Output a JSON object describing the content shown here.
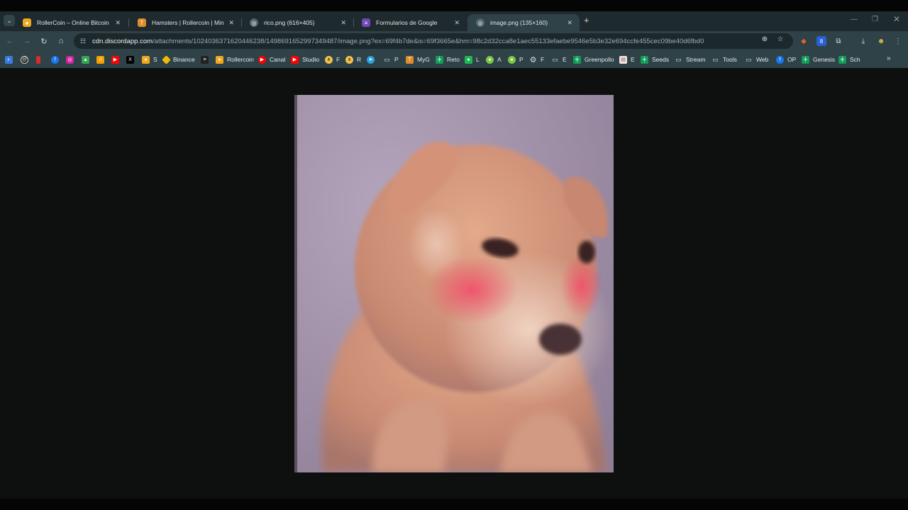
{
  "tabs": [
    {
      "title": "RollerCoin – Online Bitcoin Mining",
      "favicon": "rollercoin-hamster-icon",
      "color": "#f2a81d",
      "active": false
    },
    {
      "title": "Hamsters | Rollercoin | Minar y",
      "favicon": "hamsters-t-icon",
      "color": "#e08b2c",
      "active": false
    },
    {
      "title": "rico.png (616×405)",
      "favicon": "globe-icon",
      "color": "#8a9aa0",
      "active": false
    },
    {
      "title": "Formularios de Google",
      "favicon": "google-forms-icon",
      "color": "#7248b9",
      "active": false
    },
    {
      "title": "image.png (135×160)",
      "favicon": "globe-icon",
      "color": "#8a9aa0",
      "active": true
    }
  ],
  "address": {
    "host": "cdn.discordapp.com",
    "path": "/attachments/1024036371620446238/1498691652997349487/image.png?ex=69f4b7de&is=69f3665e&hm=98c2d32cca8e1aec55133efaebe9546e5b3e32e694ccfe455cec09be40d6fbd0"
  },
  "bookmarks": [
    {
      "label": "",
      "icon": "photos-icon",
      "color": "#3b7be0"
    },
    {
      "label": "",
      "icon": "threads-icon",
      "color": "#111111"
    },
    {
      "label": "",
      "icon": "bar-icon",
      "color": "#d92b2b"
    },
    {
      "label": "",
      "icon": "facebook-icon",
      "color": "#1877f2"
    },
    {
      "label": "",
      "icon": "instagram-icon",
      "color": "#d6249f"
    },
    {
      "label": "",
      "icon": "drive-icon",
      "color": "#34a853"
    },
    {
      "label": "",
      "icon": "analytics-icon",
      "color": "#f4a000"
    },
    {
      "label": "",
      "icon": "youtube-icon",
      "color": "#ff0000"
    },
    {
      "label": "",
      "icon": "x-icon",
      "color": "#000000"
    },
    {
      "label": "S",
      "icon": "rollercoin-icon",
      "color": "#f2a81d"
    },
    {
      "label": "Binance",
      "icon": "binance-icon",
      "color": "#f0b90b"
    },
    {
      "label": "",
      "icon": "dark-site-icon",
      "color": "#222222"
    },
    {
      "label": "Rollercoin",
      "icon": "rollercoin-icon",
      "color": "#f2a81d"
    },
    {
      "label": "Canal",
      "icon": "youtube-icon",
      "color": "#ff0000"
    },
    {
      "label": "Studio",
      "icon": "youtube-studio-icon",
      "color": "#ff0000"
    },
    {
      "label": "F",
      "icon": "hamster-icon",
      "color": "#f2c14e"
    },
    {
      "label": "R",
      "icon": "hamster-icon",
      "color": "#f2c14e"
    },
    {
      "label": "",
      "icon": "telegram-icon",
      "color": "#2aa3de"
    },
    {
      "label": "P",
      "icon": "folder-icon",
      "color": "#d7dfe1"
    },
    {
      "label": "MyG",
      "icon": "myg-icon",
      "color": "#e08b2c"
    },
    {
      "label": "Reto",
      "icon": "sheets-icon",
      "color": "#0f9d58"
    },
    {
      "label": "L",
      "icon": "green-square-icon",
      "color": "#1db954"
    },
    {
      "label": "A",
      "icon": "green-circle-icon",
      "color": "#7ac943"
    },
    {
      "label": "P",
      "icon": "green-circle-icon",
      "color": "#7ac943"
    },
    {
      "label": "F",
      "icon": "gear-icon",
      "color": "#d7dfe1"
    },
    {
      "label": "E",
      "icon": "folder-icon",
      "color": "#d7dfe1"
    },
    {
      "label": "Greenpollo",
      "icon": "sheets-icon",
      "color": "#0f9d58"
    },
    {
      "label": "E",
      "icon": "doc-icon",
      "color": "#e8e8e8"
    },
    {
      "label": "Seeds",
      "icon": "sheets-icon",
      "color": "#0f9d58"
    },
    {
      "label": "Stream",
      "icon": "folder-icon",
      "color": "#d7dfe1"
    },
    {
      "label": "Tools",
      "icon": "folder-icon",
      "color": "#d7dfe1"
    },
    {
      "label": "Web",
      "icon": "folder-icon",
      "color": "#d7dfe1"
    },
    {
      "label": "OP",
      "icon": "facebook-icon",
      "color": "#1877f2"
    },
    {
      "label": "Genesis",
      "icon": "sheets-icon",
      "color": "#0f9d58"
    },
    {
      "label": "Sch",
      "icon": "sheets-icon",
      "color": "#0f9d58"
    }
  ]
}
